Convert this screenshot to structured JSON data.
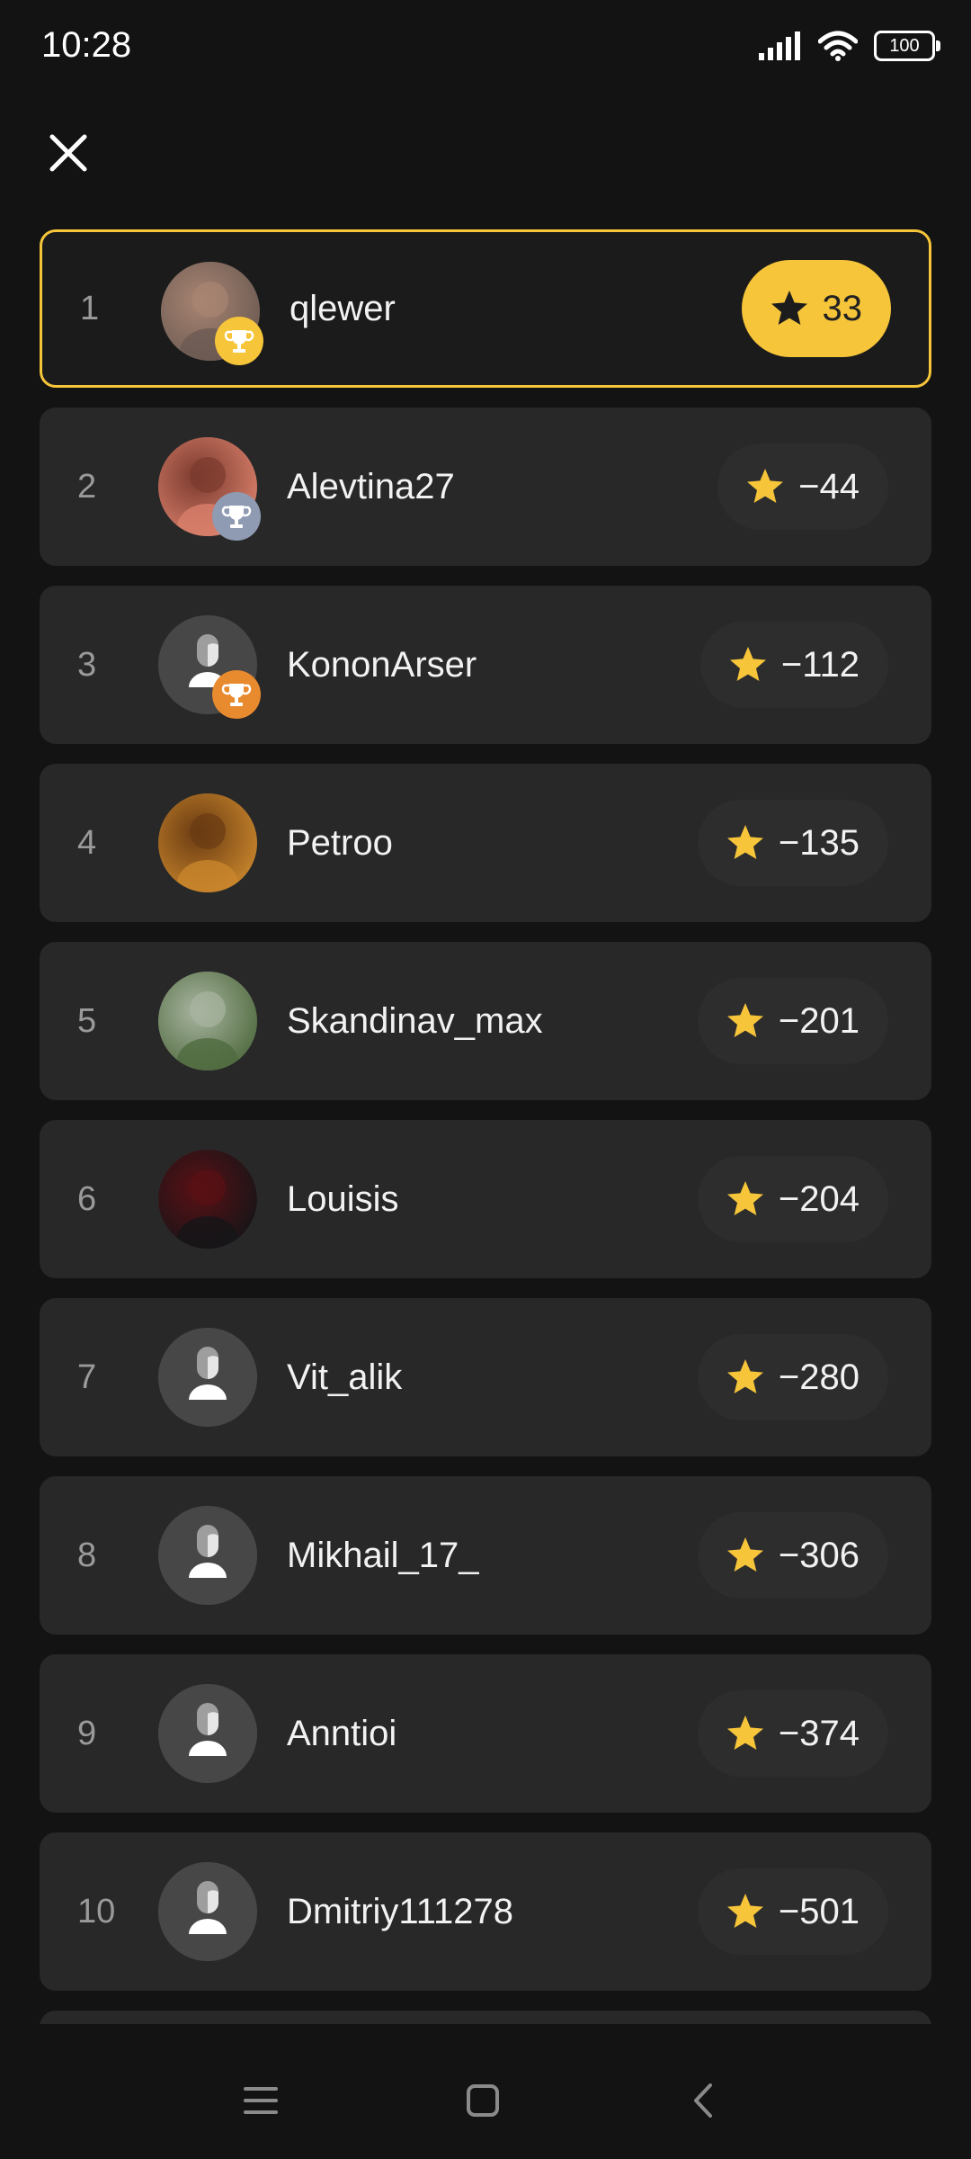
{
  "status": {
    "time": "10:28",
    "battery": "100"
  },
  "colors": {
    "accent": "#f6c53a",
    "card": "#282828",
    "background": "#131313"
  },
  "icons": {
    "close": "close-icon",
    "star": "star-icon",
    "trophy": "trophy-icon",
    "placeholder_avatar": "user-icon"
  },
  "leaderboard": [
    {
      "rank": "1",
      "name": "qlewer",
      "score": "33",
      "trophy": "gold",
      "avatar": "photo"
    },
    {
      "rank": "2",
      "name": "Alevtina27",
      "score": "−44",
      "trophy": "silver",
      "avatar": "photo"
    },
    {
      "rank": "3",
      "name": "KononArser",
      "score": "−112",
      "trophy": "bronze",
      "avatar": "placeholder"
    },
    {
      "rank": "4",
      "name": "Petroo",
      "score": "−135",
      "trophy": "",
      "avatar": "photo"
    },
    {
      "rank": "5",
      "name": "Skandinav_max",
      "score": "−201",
      "trophy": "",
      "avatar": "photo"
    },
    {
      "rank": "6",
      "name": "Louisis",
      "score": "−204",
      "trophy": "",
      "avatar": "photo"
    },
    {
      "rank": "7",
      "name": "Vit_alik",
      "score": "−280",
      "trophy": "",
      "avatar": "placeholder"
    },
    {
      "rank": "8",
      "name": "Mikhail_17_",
      "score": "−306",
      "trophy": "",
      "avatar": "placeholder"
    },
    {
      "rank": "9",
      "name": "Anntioi",
      "score": "−374",
      "trophy": "",
      "avatar": "placeholder"
    },
    {
      "rank": "10",
      "name": "Dmitriy111278",
      "score": "−501",
      "trophy": "",
      "avatar": "placeholder"
    }
  ]
}
